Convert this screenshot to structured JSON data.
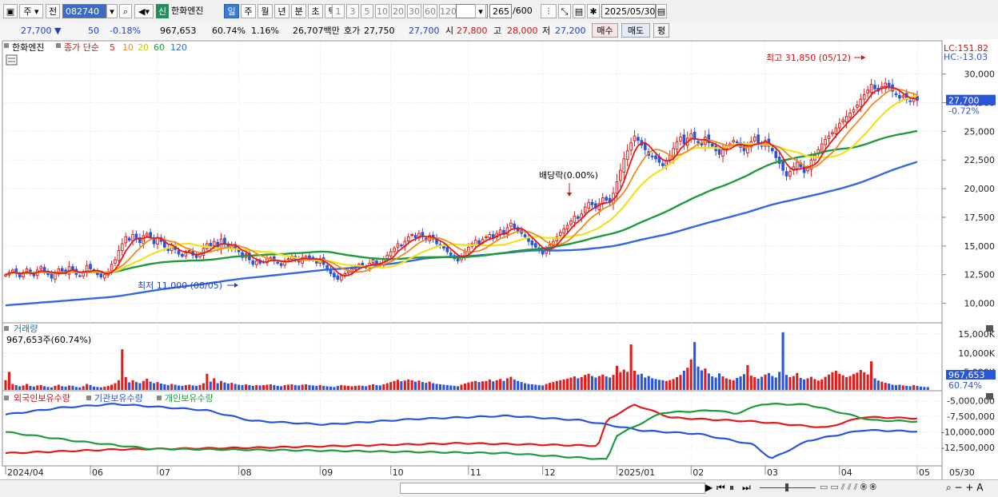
{
  "toolbar": {
    "type_select": "주",
    "prev_label": "전",
    "code": "082740",
    "sin_badge": "신",
    "stock_name": "한화엔진",
    "periods": [
      "일",
      "주",
      "월",
      "년",
      "분",
      "초",
      "틱"
    ],
    "active_period": "일",
    "intervals": [
      "1",
      "3",
      "5",
      "10",
      "20",
      "30",
      "60",
      "120"
    ],
    "count": "265",
    "count_total": "/600",
    "date": "2025/05/30"
  },
  "quote": {
    "price": "27,700",
    "change": "50",
    "change_pct": "-0.18%",
    "volume": "967,653",
    "turnover": "60.74%",
    "vol_ratio": "1.16%",
    "trade_value": "26,707백만",
    "ask_label": "호가",
    "ask": "27,750",
    "bid": "27,700",
    "open_label": "시",
    "open": "27,800",
    "high_label": "고",
    "high": "28,000",
    "low_label": "저",
    "low": "27,200",
    "buy_button": "매수",
    "sell_button": "매도",
    "eval_button": "평"
  },
  "colors": {
    "up": "#e31b1b",
    "down": "#2a55d8",
    "ma5": "#e31b1b",
    "ma10": "#f08a20",
    "ma20": "#f2e21a",
    "ma60": "#1f9b3e",
    "ma120": "#3468e0"
  },
  "chart_data": [
    {
      "type": "candlestick",
      "legend": {
        "stock": "한화엔진",
        "price_label": "종가 단순",
        "ma_periods": [
          "5",
          "10",
          "20",
          "60",
          "120"
        ]
      },
      "right_info": [
        "LC:151.82",
        "HC:-13.03"
      ],
      "current_price_label": "27,700",
      "current_change_label": "-0.72%",
      "y_ticks": [
        "30,000",
        "27,500",
        "25,000",
        "22,500",
        "20,000",
        "17,500",
        "15,000",
        "12,500",
        "10,000"
      ],
      "y_tick_values": [
        30000,
        27500,
        25000,
        22500,
        20000,
        17500,
        15000,
        12500,
        10000
      ],
      "ylim": [
        8300,
        32900
      ],
      "annotations": {
        "high": "최고 31,850 (05/12)",
        "low": "최저 11,000 (08/05)",
        "dividend": "배당락(0.00%)"
      },
      "close": [
        12500,
        12700,
        12900,
        12600,
        12300,
        12700,
        13000,
        12600,
        12400,
        12900,
        13200,
        12800,
        12500,
        12200,
        12600,
        13000,
        12800,
        12600,
        13200,
        12900,
        12500,
        12400,
        12700,
        13300,
        13000,
        12800,
        12500,
        12300,
        12500,
        12800,
        13400,
        13800,
        14600,
        15200,
        15800,
        15500,
        16000,
        15600,
        15300,
        15900,
        16100,
        15800,
        15200,
        15700,
        15400,
        14900,
        14600,
        15000,
        14700,
        14300,
        14100,
        14400,
        14600,
        14200,
        14000,
        14300,
        14800,
        15200,
        14900,
        15400,
        14800,
        15600,
        15200,
        14800,
        15100,
        14700,
        14500,
        14000,
        14300,
        13800,
        13400,
        13700,
        13500,
        13600,
        13900,
        14000,
        13700,
        13500,
        13300,
        13700,
        13900,
        14100,
        13800,
        13600,
        14000,
        14100,
        13900,
        13800,
        13500,
        13900,
        13400,
        13000,
        12600,
        12300,
        12100,
        12400,
        12600,
        12800,
        13000,
        13200,
        13400,
        13300,
        13100,
        13500,
        13800,
        13500,
        13300,
        13800,
        14200,
        14500,
        14800,
        15200,
        15000,
        15400,
        15800,
        16000,
        15700,
        16100,
        15800,
        15500,
        15900,
        15600,
        15200,
        15000,
        14800,
        14500,
        14200,
        13900,
        13700,
        14100,
        14500,
        14900,
        15200,
        15500,
        15200,
        15600,
        15800,
        16000,
        15700,
        16100,
        16400,
        16000,
        16600,
        17000,
        16600,
        16300,
        16100,
        15800,
        15400,
        15100,
        14900,
        14600,
        14300,
        14700,
        15100,
        15400,
        15800,
        16200,
        16500,
        16800,
        17200,
        17600,
        17400,
        17800,
        18400,
        18800,
        18600,
        18300,
        18700,
        19200,
        19000,
        18800,
        19600,
        20600,
        21600,
        22600,
        23300,
        24000,
        24600,
        24200,
        23800,
        23400,
        22900,
        22800,
        22600,
        22300,
        22000,
        22400,
        22900,
        23500,
        24100,
        24500,
        23900,
        24400,
        24800,
        24300,
        24000,
        23800,
        24500,
        24000,
        23700,
        23300,
        23000,
        23400,
        23700,
        23900,
        24200,
        24000,
        23600,
        23300,
        23700,
        24100,
        24500,
        24000,
        23700,
        24200,
        23700,
        23300,
        22700,
        22200,
        21600,
        21100,
        21500,
        21900,
        22300,
        21900,
        21400,
        21800,
        22500,
        22900,
        23400,
        23900,
        24300,
        24600,
        24900,
        25300,
        25700,
        26000,
        26300,
        26600,
        26900,
        27300,
        27800,
        28200,
        28600,
        29100,
        28700,
        28500,
        28900,
        29200,
        28900,
        28500,
        28200,
        27900,
        28100,
        27800,
        27600,
        27900,
        27700
      ],
      "volume_panel": {
        "label": "거래량",
        "info": "967,653주(60.74%)",
        "y_ticks": [
          "15,000K",
          "10,000K",
          "5,000K"
        ],
        "y_tick_values": [
          15000000,
          10000000,
          5000000
        ],
        "ylim": [
          0,
          17800000
        ],
        "current_label": "967,653",
        "current_pct": "60.74%",
        "values": [
          2800000,
          5000000,
          1800000,
          1500000,
          1200000,
          1400000,
          1800000,
          1300000,
          1100000,
          1400000,
          1500000,
          1200000,
          1000000,
          900000,
          1300000,
          1600000,
          1200000,
          1100000,
          1400000,
          1300000,
          1000000,
          900000,
          1200000,
          1800000,
          1500000,
          1100000,
          1000000,
          900000,
          1100000,
          1300000,
          1600000,
          2000000,
          2800000,
          11000000,
          3600000,
          2200000,
          2800000,
          2300000,
          2000000,
          2600000,
          3200000,
          2400000,
          2000000,
          2300000,
          1900000,
          1700000,
          1500000,
          1800000,
          1600000,
          1400000,
          1300000,
          1500000,
          1600000,
          1400000,
          1300000,
          1500000,
          2000000,
          4500000,
          2400000,
          3300000,
          2000000,
          2600000,
          2200000,
          1900000,
          2100000,
          1800000,
          1600000,
          1500000,
          1700000,
          1500000,
          1300000,
          1500000,
          1400000,
          1500000,
          1600000,
          1700000,
          1500000,
          1300000,
          1200000,
          1500000,
          1600000,
          1700000,
          1500000,
          1400000,
          1600000,
          1700000,
          1500000,
          1400000,
          1300000,
          1500000,
          1300000,
          1200000,
          1100000,
          1000000,
          1300000,
          1500000,
          1400000,
          1300000,
          1200000,
          1300000,
          1400000,
          1300000,
          1200000,
          1500000,
          1700000,
          1500000,
          1400000,
          1700000,
          2000000,
          2300000,
          2600000,
          2900000,
          2500000,
          2700000,
          3000000,
          2800000,
          2400000,
          2700000,
          2300000,
          2100000,
          2400000,
          2000000,
          1800000,
          1700000,
          1600000,
          1500000,
          1400000,
          1300000,
          1200000,
          1600000,
          1900000,
          2200000,
          2400000,
          2600000,
          2300000,
          2500000,
          2600000,
          3000000,
          2500000,
          2800000,
          3100000,
          2600000,
          3300000,
          3700000,
          3000000,
          2600000,
          2300000,
          2000000,
          1800000,
          1700000,
          1600000,
          1500000,
          1400000,
          1800000,
          2100000,
          2300000,
          2600000,
          2800000,
          3000000,
          3200000,
          3500000,
          3800000,
          3300000,
          3600000,
          4200000,
          4500000,
          3900000,
          3500000,
          3900000,
          4300000,
          3800000,
          3500000,
          4200000,
          6600000,
          4900000,
          5600000,
          5000000,
          12300000,
          5300000,
          4300000,
          4500000,
          3500000,
          3900000,
          3300000,
          3100000,
          2900000,
          2800000,
          2600000,
          2800000,
          3100000,
          3600000,
          4200000,
          5300000,
          6100000,
          8300000,
          12900000,
          6400000,
          5400000,
          5900000,
          4600000,
          3800000,
          3500000,
          4600000,
          3800000,
          3300000,
          3000000,
          2800000,
          3400000,
          3800000,
          4400000,
          6800000,
          4000000,
          3600000,
          3200000,
          3700000,
          4300000,
          4700000,
          3900000,
          3500000,
          5000000,
          15500000,
          4200000,
          3600000,
          3900000,
          4700000,
          3400000,
          3000000,
          3300000,
          3700000,
          3100000,
          2700000,
          3000000,
          3700000,
          4300000,
          4900000,
          5300000,
          4500000,
          4100000,
          3600000,
          3900000,
          4400000,
          4800000,
          5500000,
          4900000,
          4300000,
          7800000,
          3300000,
          2700000,
          2400000,
          2100000,
          1900000,
          1600000,
          1500000,
          1600000,
          1400000,
          1300000,
          1200000,
          1500000,
          1300000,
          1100000,
          1000000,
          967653
        ]
      },
      "holdings_panel": {
        "series": [
          {
            "name": "외국인보유수량",
            "color": "#e31b1b"
          },
          {
            "name": "기관보유수량",
            "color": "#2a55d8"
          },
          {
            "name": "개인보유수량",
            "color": "#1f9b3e"
          }
        ],
        "y_ticks": [
          "-5,000,000",
          "-7,500,000",
          "-10,000,000",
          "-12,500,000"
        ],
        "y_tick_values": [
          -5000000,
          -7500000,
          -10000000,
          -12500000
        ],
        "ylim": [
          -15300000,
          -3500000
        ]
      },
      "x_ticks": [
        "2024/04",
        "06",
        "07",
        "08",
        "09",
        "10",
        "11",
        "12",
        "2025/01",
        "02",
        "03",
        "04",
        "05"
      ],
      "x_tick_index": [
        0,
        24,
        43,
        66,
        89,
        109,
        131,
        152,
        173,
        194,
        215,
        236,
        258
      ],
      "x_end_label": "05/30"
    }
  ]
}
